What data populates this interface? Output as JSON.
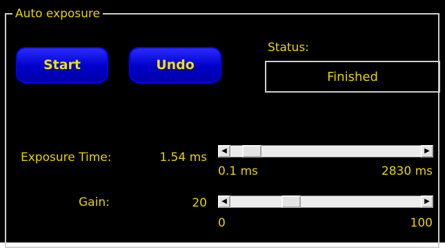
{
  "group": {
    "title": "Auto exposure"
  },
  "buttons": {
    "start": "Start",
    "undo": "Undo"
  },
  "status": {
    "label": "Status:",
    "value": "Finished"
  },
  "exposure": {
    "label": "Exposure Time:",
    "value": "1.54 ms",
    "min_label": "0.1 ms",
    "max_label": "2830 ms",
    "position_fraction": 0.07
  },
  "gain": {
    "label": "Gain:",
    "value": "20",
    "min_label": "0",
    "max_label": "100",
    "position_fraction": 0.3
  },
  "colors": {
    "text": "#e8d200",
    "button": "#0000c8",
    "background": "#000000"
  },
  "icons": {
    "scroll_left": "left-arrow-icon",
    "scroll_right": "right-arrow-icon"
  }
}
